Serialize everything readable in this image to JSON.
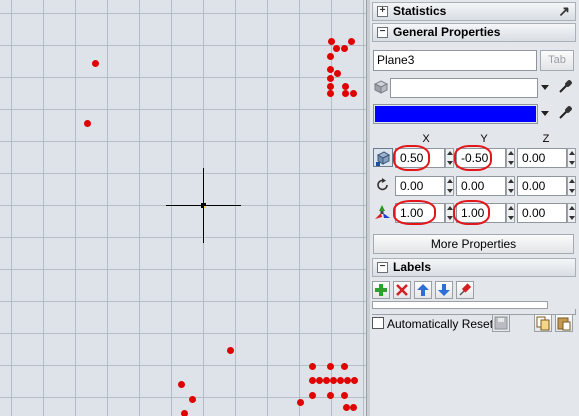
{
  "panel": {
    "statistics": {
      "title": "Statistics",
      "toggle": "+"
    },
    "general": {
      "title": "General Properties",
      "toggle": "−",
      "name_value": "Plane3",
      "name_button": "Tab",
      "color_value": "",
      "swatch_color": "#0000ff",
      "axes": [
        "X",
        "Y",
        "Z"
      ],
      "position": {
        "x": "0.50",
        "y": "-0.50",
        "z": "0.00"
      },
      "rotation": {
        "x": "0.00",
        "y": "0.00",
        "z": "0.00"
      },
      "scale": {
        "x": "1.00",
        "y": "1.00",
        "z": "0.00"
      },
      "more_button": "More Properties"
    },
    "labels": {
      "title": "Labels",
      "toggle": "−",
      "auto_reset_label": "Automatically Reset",
      "auto_reset_checked": false
    }
  },
  "colors": {
    "marker": "#e00000",
    "annotation": "#e2161b",
    "swatch": "#0000ff"
  }
}
